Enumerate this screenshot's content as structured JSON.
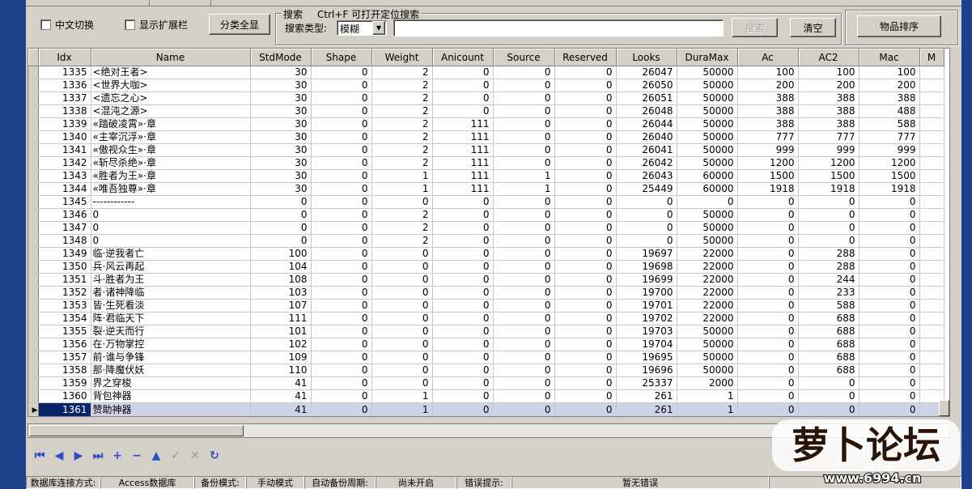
{
  "toolbar": {
    "chinese_toggle_label": "中文切换",
    "show_extension_label": "显示扩展栏",
    "category_show_all_label": "分类全显",
    "search_group_title": "搜索",
    "search_hint": "Ctrl+F 可打开定位搜索",
    "search_type_label": "搜索类型:",
    "search_type_value": "模糊",
    "search_query_value": "",
    "search_button_label": "搜索",
    "clear_button_label": "清空",
    "sort_items_label": "物品排序"
  },
  "grid": {
    "columns": [
      "Idx",
      "Name",
      "StdMode",
      "Shape",
      "Weight",
      "Anicount",
      "Source",
      "Reserved",
      "Looks",
      "DuraMax",
      "Ac",
      "AC2",
      "Mac",
      "M"
    ],
    "selected_idx": "1361",
    "rows": [
      [
        "1335",
        "<绝对王者>",
        "30",
        "0",
        "2",
        "0",
        "0",
        "0",
        "26047",
        "50000",
        "100",
        "100",
        "100"
      ],
      [
        "1336",
        "<世界大咖>",
        "30",
        "0",
        "2",
        "0",
        "0",
        "0",
        "26050",
        "50000",
        "200",
        "200",
        "200"
      ],
      [
        "1337",
        "<遗忘之心>",
        "30",
        "0",
        "2",
        "0",
        "0",
        "0",
        "26051",
        "50000",
        "388",
        "388",
        "388"
      ],
      [
        "1338",
        "<混沌之源>",
        "30",
        "0",
        "2",
        "0",
        "0",
        "0",
        "26048",
        "50000",
        "388",
        "388",
        "488"
      ],
      [
        "1339",
        "«踏破凌霄»·章",
        "30",
        "0",
        "2",
        "111",
        "0",
        "0",
        "26044",
        "50000",
        "388",
        "388",
        "588"
      ],
      [
        "1340",
        "«主宰沉浮»·章",
        "30",
        "0",
        "2",
        "111",
        "0",
        "0",
        "26040",
        "50000",
        "777",
        "777",
        "777"
      ],
      [
        "1341",
        "«傲视众生»·章",
        "30",
        "0",
        "2",
        "111",
        "0",
        "0",
        "26041",
        "50000",
        "999",
        "999",
        "999"
      ],
      [
        "1342",
        "«斩尽杀绝»·章",
        "30",
        "0",
        "2",
        "111",
        "0",
        "0",
        "26042",
        "50000",
        "1200",
        "1200",
        "1200"
      ],
      [
        "1343",
        "«胜者为王»·章",
        "30",
        "0",
        "1",
        "111",
        "1",
        "0",
        "26043",
        "60000",
        "1500",
        "1500",
        "1500"
      ],
      [
        "1344",
        "«唯吾独尊»·章",
        "30",
        "0",
        "1",
        "111",
        "1",
        "0",
        "25449",
        "60000",
        "1918",
        "1918",
        "1918"
      ],
      [
        "1345",
        "------------",
        "0",
        "0",
        "0",
        "0",
        "0",
        "0",
        "0",
        "0",
        "0",
        "0",
        "0"
      ],
      [
        "1346",
        "0",
        "0",
        "0",
        "2",
        "0",
        "0",
        "0",
        "0",
        "50000",
        "0",
        "0",
        "0"
      ],
      [
        "1347",
        "0",
        "0",
        "0",
        "2",
        "0",
        "0",
        "0",
        "0",
        "50000",
        "0",
        "0",
        "0"
      ],
      [
        "1348",
        "0",
        "0",
        "0",
        "2",
        "0",
        "0",
        "0",
        "0",
        "50000",
        "0",
        "0",
        "0"
      ],
      [
        "1349",
        "临·逆我者亡",
        "100",
        "0",
        "0",
        "0",
        "0",
        "0",
        "19697",
        "22000",
        "0",
        "288",
        "0"
      ],
      [
        "1350",
        "兵·风云再起",
        "104",
        "0",
        "0",
        "0",
        "0",
        "0",
        "19698",
        "22000",
        "0",
        "288",
        "0"
      ],
      [
        "1351",
        "斗·胜者为王",
        "108",
        "0",
        "0",
        "0",
        "0",
        "0",
        "19699",
        "22000",
        "0",
        "244",
        "0"
      ],
      [
        "1352",
        "者·诸神降临",
        "103",
        "0",
        "0",
        "0",
        "0",
        "0",
        "19700",
        "22000",
        "0",
        "233",
        "0"
      ],
      [
        "1353",
        "皆·生死看淡",
        "107",
        "0",
        "0",
        "0",
        "0",
        "0",
        "19701",
        "22000",
        "0",
        "588",
        "0"
      ],
      [
        "1354",
        "阵·君临天下",
        "111",
        "0",
        "0",
        "0",
        "0",
        "0",
        "19702",
        "22000",
        "0",
        "688",
        "0"
      ],
      [
        "1355",
        "裂·逆天而行",
        "101",
        "0",
        "0",
        "0",
        "0",
        "0",
        "19703",
        "50000",
        "0",
        "688",
        "0"
      ],
      [
        "1356",
        "在·万物掌控",
        "102",
        "0",
        "0",
        "0",
        "0",
        "0",
        "19704",
        "50000",
        "0",
        "688",
        "0"
      ],
      [
        "1357",
        "前·谁与争锋",
        "109",
        "0",
        "0",
        "0",
        "0",
        "0",
        "19695",
        "50000",
        "0",
        "688",
        "0"
      ],
      [
        "1358",
        "那·降魔伏妖",
        "110",
        "0",
        "0",
        "0",
        "0",
        "0",
        "19696",
        "50000",
        "0",
        "688",
        "0"
      ],
      [
        "1359",
        "界之穿梭",
        "41",
        "0",
        "0",
        "0",
        "0",
        "0",
        "25337",
        "2000",
        "0",
        "0",
        "0"
      ],
      [
        "1360",
        "背包神器",
        "41",
        "0",
        "1",
        "0",
        "0",
        "0",
        "261",
        "1",
        "0",
        "0",
        "0"
      ],
      [
        "1361",
        "赞助神器",
        "41",
        "0",
        "1",
        "0",
        "0",
        "0",
        "261",
        "1",
        "0",
        "0",
        "0"
      ]
    ]
  },
  "nav": {
    "icons": [
      "first-icon",
      "prior-icon",
      "next-icon",
      "last-icon",
      "insert-icon",
      "delete-icon",
      "edit-icon",
      "post-icon",
      "cancel-icon",
      "refresh-icon"
    ]
  },
  "status": {
    "db_connection_label": "数据库连接方式:",
    "db_connection_value": "Access数据库",
    "backup_mode_label": "备份模式:",
    "backup_mode_value": "手动模式",
    "auto_backup_label": "自动备份周期:",
    "auto_backup_value": "尚未开启",
    "error_label": "错误提示:",
    "error_value": "暂无错误"
  },
  "watermark": {
    "logo_text": "萝卜论坛",
    "site": "www.6994.cn"
  }
}
